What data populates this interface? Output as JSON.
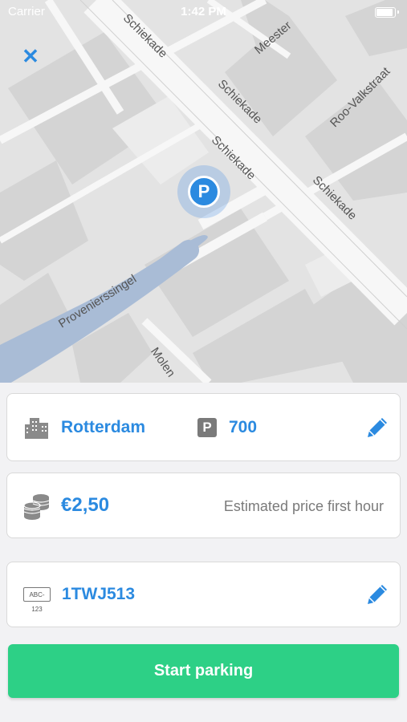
{
  "status_bar": {
    "carrier": "Carrier",
    "time": "1:42 PM"
  },
  "map": {
    "streets": {
      "schiekade_1": "Schiekade",
      "schiekade_2": "Schiekade",
      "schiekade_3": "Schiekade",
      "schiekade_4": "Schiekade",
      "meester": "Meester",
      "roo_valkstraat": "Roo-Valkstraat",
      "provenierssingel": "Provenierssingel",
      "molen": "Molen"
    },
    "pin_label": "P"
  },
  "location_card": {
    "city": "Rotterdam",
    "zone_badge": "P",
    "zone_number": "700"
  },
  "price_card": {
    "price": "€2,50",
    "description": "Estimated price first hour"
  },
  "plate_card": {
    "plate_icon_text": "ABC-123",
    "plate": "1TWJ513"
  },
  "actions": {
    "start_label": "Start parking"
  },
  "colors": {
    "accent": "#2b8ae0",
    "start_button": "#2dd086"
  }
}
